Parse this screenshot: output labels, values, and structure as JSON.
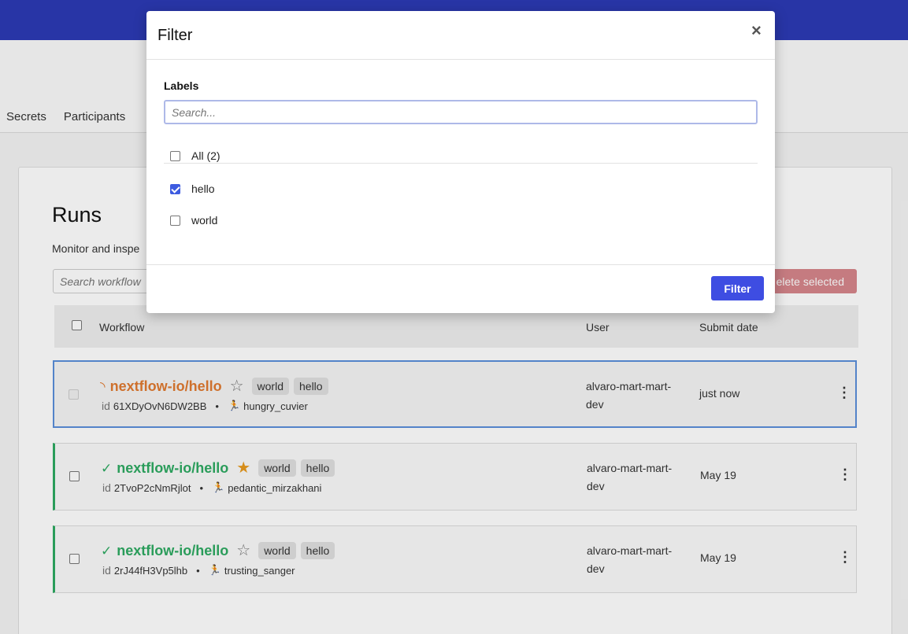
{
  "nav": {
    "tabs": [
      {
        "label": "Secrets"
      },
      {
        "label": "Participants"
      }
    ]
  },
  "runs": {
    "title": "Runs",
    "subtitle": "Monitor and inspe",
    "search_placeholder": "Search workflow",
    "delete_label": "elete selected",
    "columns": {
      "workflow": "Workflow",
      "user": "User",
      "submit_date": "Submit date"
    },
    "rows": [
      {
        "status": "running",
        "status_icon": "◝",
        "name": "nextflow-io/hello",
        "starred": false,
        "star_glyph": "☆",
        "tags": [
          "world",
          "hello"
        ],
        "id_label": "id",
        "id": "61XDyOvN6DW2BB",
        "run_name": "hungry_cuvier",
        "user": "alvaro-mart-mart-dev",
        "date": "just now",
        "menu": "⋮"
      },
      {
        "status": "succeeded",
        "status_icon": "✓",
        "name": "nextflow-io/hello",
        "starred": true,
        "star_glyph": "★",
        "tags": [
          "world",
          "hello"
        ],
        "id_label": "id",
        "id": "2TvoP2cNmRjlot",
        "run_name": "pedantic_mirzakhani",
        "user": "alvaro-mart-mart-dev",
        "date": "May 19",
        "menu": "⋮"
      },
      {
        "status": "succeeded",
        "status_icon": "✓",
        "name": "nextflow-io/hello",
        "starred": false,
        "star_glyph": "☆",
        "tags": [
          "world",
          "hello"
        ],
        "id_label": "id",
        "id": "2rJ44fH3Vp5lhb",
        "run_name": "trusting_sanger",
        "user": "alvaro-mart-mart-dev",
        "date": "May 19",
        "menu": "⋮"
      }
    ]
  },
  "modal": {
    "title": "Filter",
    "close_glyph": "×",
    "labels_heading": "Labels",
    "search_placeholder": "Search...",
    "all_option": "All (2)",
    "options": [
      {
        "label": "hello",
        "checked": true
      },
      {
        "label": "world",
        "checked": false
      }
    ],
    "filter_button": "Filter"
  },
  "colors": {
    "topbar": "#2c3ab5",
    "running": "#e07a30",
    "succeeded": "#2eaa62",
    "star_filled": "#e89a1e",
    "primary_button": "#3e4de2",
    "danger_button": "#d6868b"
  }
}
